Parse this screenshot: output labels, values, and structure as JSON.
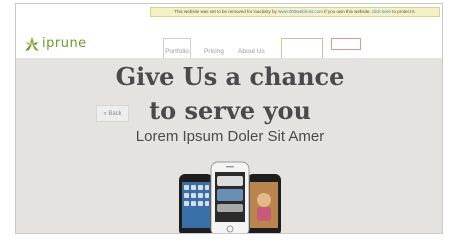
{
  "notice": {
    "text_before": "This website was set to be removed for inactivity by",
    "link1": "www.000webhost.com",
    "text_middle": "If you own this website,",
    "link2": "click here",
    "text_after": "to protect it."
  },
  "header": {
    "logo_text": "iprune",
    "nav": {
      "portfolio": "Portfolio",
      "pricing": "Pricing",
      "about": "About Us"
    }
  },
  "hero": {
    "title_line1": "Give Us a chance",
    "title_line2": "to serve you",
    "subtitle": "Lorem Ipsum Doler Sit Amer",
    "back_label": "« Back"
  },
  "colors": {
    "logo_green": "#6c9a2e",
    "hero_background": "#e5e3e0",
    "headline": "#4a4a4a",
    "notice_background": "#f4f1c7"
  },
  "icons": [
    "logo-mark-icon",
    "phones-illustration"
  ]
}
